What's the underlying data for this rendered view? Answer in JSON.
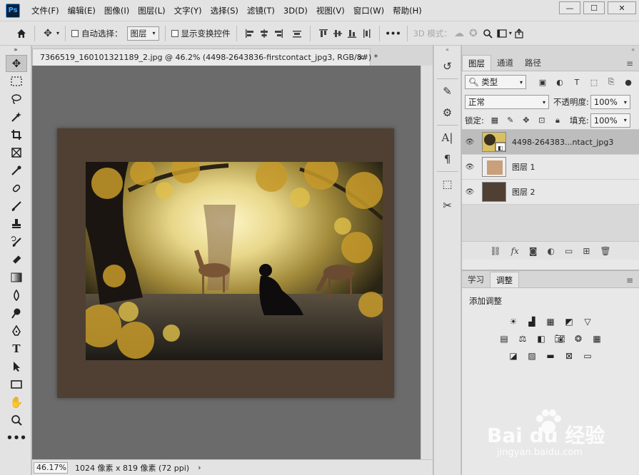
{
  "app": {
    "logo": "Ps",
    "menus": [
      "文件(F)",
      "编辑(E)",
      "图像(I)",
      "图层(L)",
      "文字(Y)",
      "选择(S)",
      "滤镜(T)",
      "3D(D)",
      "视图(V)",
      "窗口(W)",
      "帮助(H)"
    ],
    "window_controls": [
      "—",
      "☐",
      "✕"
    ]
  },
  "options": {
    "auto_select_label": "自动选择：",
    "auto_select_value": "图层",
    "show_transform_label": "显示变换控件",
    "more": "•••",
    "mode_3d_label": "3D 模式："
  },
  "document": {
    "tab_title": "7366519_160101321189_2.jpg @ 46.2% (4498-2643836-firstcontact_jpg3, RGB/8#) *",
    "tab_close": "×",
    "zoom": "46.17%",
    "dimensions": "1024 像素 x 819 像素 (72 ppi)",
    "status_arrow": "›"
  },
  "layers_panel": {
    "tabs": [
      "图层",
      "通道",
      "路径"
    ],
    "filter_kind": "类型",
    "blend_mode": "正常",
    "opacity_label": "不透明度:",
    "opacity_value": "100%",
    "lock_label": "锁定:",
    "fill_label": "填充:",
    "fill_value": "100%",
    "layers": [
      {
        "name": "4498-264383...ntact_jpg3",
        "selected": true
      },
      {
        "name": "图层 1",
        "selected": false
      },
      {
        "name": "图层 2",
        "selected": false
      }
    ]
  },
  "adjust_panel": {
    "tabs": [
      "学习",
      "调整"
    ],
    "title": "添加调整"
  },
  "watermark": {
    "brand": "Bai du 经验",
    "url": "jingyan.baidu.com"
  },
  "colors": {
    "doc_bg": "#4f4033",
    "canvas": "#6b6b6b",
    "panel": "#e8e8e8",
    "selected_layer": "#bdbdbd"
  }
}
